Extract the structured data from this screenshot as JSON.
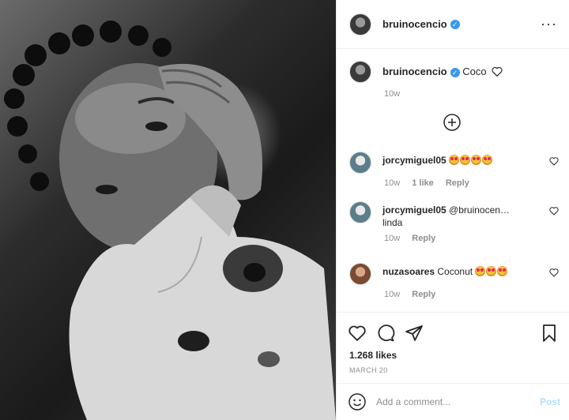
{
  "post": {
    "author": "bruinocencio",
    "caption_text": "Coco",
    "caption_age": "10w",
    "likes": "1.268 likes",
    "date": "MARCH 20"
  },
  "comments": [
    {
      "user": "jorcymiguel05",
      "text": "",
      "emoji_count": 4,
      "age": "10w",
      "likes": "1 like",
      "reply": "Reply"
    },
    {
      "user": "jorcymiguel05",
      "text": "@bruinocen…\nlinda",
      "emoji_count": 0,
      "age": "10w",
      "likes": "",
      "reply": "Reply"
    },
    {
      "user": "nuzasoares",
      "text": "Coconut",
      "emoji_count": 3,
      "age": "10w",
      "likes": "",
      "reply": "Reply"
    }
  ],
  "composer": {
    "placeholder": "Add a comment...",
    "post_label": "Post"
  },
  "icons": {
    "header_more": "more-dots-icon",
    "load_more": "plus-circle-icon",
    "like": "heart-icon",
    "comment": "comment-icon",
    "share": "paper-plane-icon",
    "save": "bookmark-icon",
    "emoji": "smiley-icon"
  },
  "colors": {
    "verified": "#3897f0",
    "muted_text": "#8e8e8e",
    "post_disabled": "#b2dffc"
  }
}
